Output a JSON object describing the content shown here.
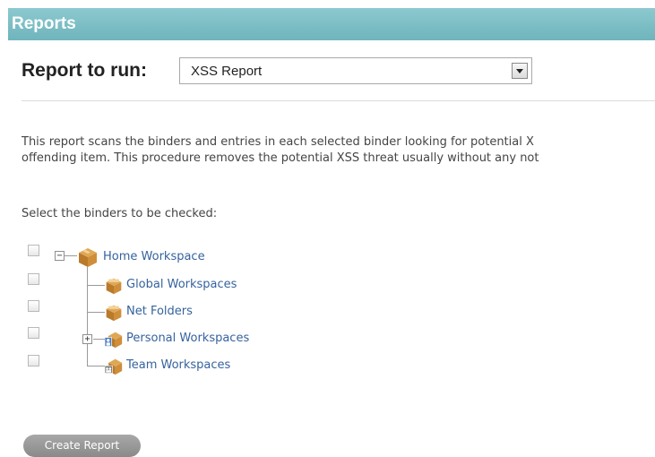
{
  "header": {
    "title": "Reports"
  },
  "report_select": {
    "label": "Report to run:",
    "selected": "XSS Report"
  },
  "description": {
    "line1": "This report scans the binders and entries in each selected binder looking for potential X",
    "line2": "offending item. This procedure removes the potential XSS threat usually without any not"
  },
  "instruction": "Select the binders to be checked:",
  "tree": {
    "root": {
      "label": "Home Workspace",
      "toggle": "−"
    },
    "children": [
      {
        "label": "Global Workspaces"
      },
      {
        "label": "Net Folders"
      },
      {
        "label": "Personal Workspaces",
        "toggle": "+"
      },
      {
        "label": "Team Workspaces"
      }
    ]
  },
  "actions": {
    "create_report": "Create Report"
  }
}
